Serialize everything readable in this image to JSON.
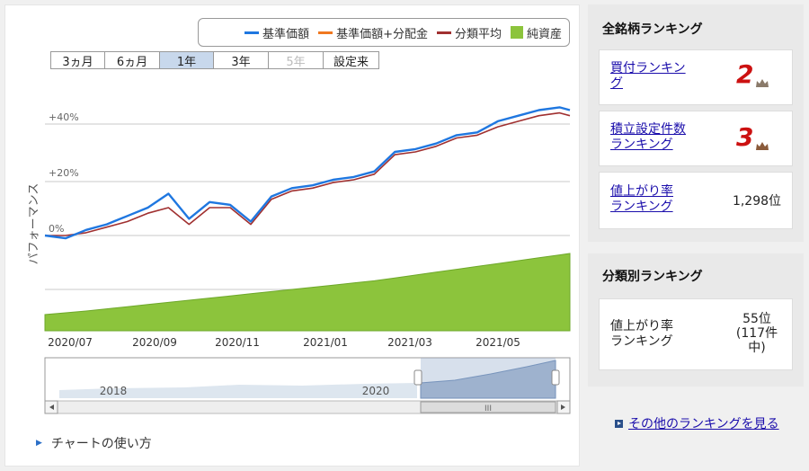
{
  "legend": [
    {
      "label": "基準価額",
      "color": "#1f77e0",
      "type": "line"
    },
    {
      "label": "基準価額+分配金",
      "color": "#f07820",
      "type": "line"
    },
    {
      "label": "分類平均",
      "color": "#a03030",
      "type": "line"
    },
    {
      "label": "純資産",
      "color": "#8cc43c",
      "type": "box"
    }
  ],
  "range_buttons": [
    {
      "label": "3ヵ月",
      "state": "normal"
    },
    {
      "label": "6ヵ月",
      "state": "normal"
    },
    {
      "label": "1年",
      "state": "active"
    },
    {
      "label": "3年",
      "state": "normal"
    },
    {
      "label": "5年",
      "state": "disabled"
    },
    {
      "label": "設定来",
      "state": "normal"
    }
  ],
  "chart_data": {
    "type": "line",
    "ylabel": "パフォーマンス",
    "y_ticks": [
      "0%",
      "+20%",
      "+40%"
    ],
    "ylim": [
      -5,
      48
    ],
    "x_ticks": [
      "2020/07",
      "2020/09",
      "2020/11",
      "2021/01",
      "2021/03",
      "2021/05"
    ],
    "x": [
      0,
      2,
      4,
      6,
      8,
      10,
      12,
      14,
      16,
      18,
      20,
      22,
      24,
      26,
      28,
      30,
      32,
      34,
      36,
      38,
      40,
      42,
      44,
      46,
      48,
      50,
      51
    ],
    "series": [
      {
        "name": "基準価額",
        "color": "#1f77e0",
        "values": [
          0,
          -1,
          2,
          4,
          7,
          10,
          15,
          6,
          12,
          11,
          5,
          14,
          17,
          18,
          20,
          21,
          23,
          30,
          31,
          33,
          36,
          37,
          41,
          43,
          45,
          46,
          45
        ]
      },
      {
        "name": "分類平均",
        "color": "#a03030",
        "values": [
          0,
          0,
          1,
          3,
          5,
          8,
          10,
          4,
          10,
          10,
          4,
          13,
          16,
          17,
          19,
          20,
          22,
          29,
          30,
          32,
          35,
          36,
          39,
          41,
          43,
          44,
          43
        ]
      }
    ],
    "area": {
      "name": "純資産",
      "color": "#8cc43c",
      "values": [
        4,
        4.5,
        5,
        5.6,
        6.2,
        6.8,
        7.4,
        8,
        8.6,
        9.2,
        9.8,
        10.4,
        11,
        11.6,
        12.2,
        12.8,
        13.4,
        14.2,
        15,
        15.8,
        16.6,
        17.4,
        18.2,
        19,
        19.8,
        20.6,
        21
      ]
    },
    "navigator": {
      "labels": [
        "2018",
        "2020"
      ],
      "scroll_center": "III"
    }
  },
  "howto_label": "チャートの使い方",
  "all_ranking": {
    "title": "全銘柄ランキング",
    "items": [
      {
        "label_lines": [
          "買付ランキン",
          "グ"
        ],
        "rank": "2"
      },
      {
        "label_lines": [
          "積立設定件数",
          "ランキング"
        ],
        "rank": "3"
      },
      {
        "label_lines": [
          "値上がり率",
          "ランキング"
        ],
        "value": "1,298位"
      }
    ]
  },
  "category_ranking": {
    "title": "分類別ランキング",
    "item": {
      "label_lines": [
        "値上がり率",
        "ランキング"
      ],
      "value_lines": [
        "55位",
        "(117件",
        "中)"
      ]
    }
  },
  "other_link": "その他のランキングを見る"
}
